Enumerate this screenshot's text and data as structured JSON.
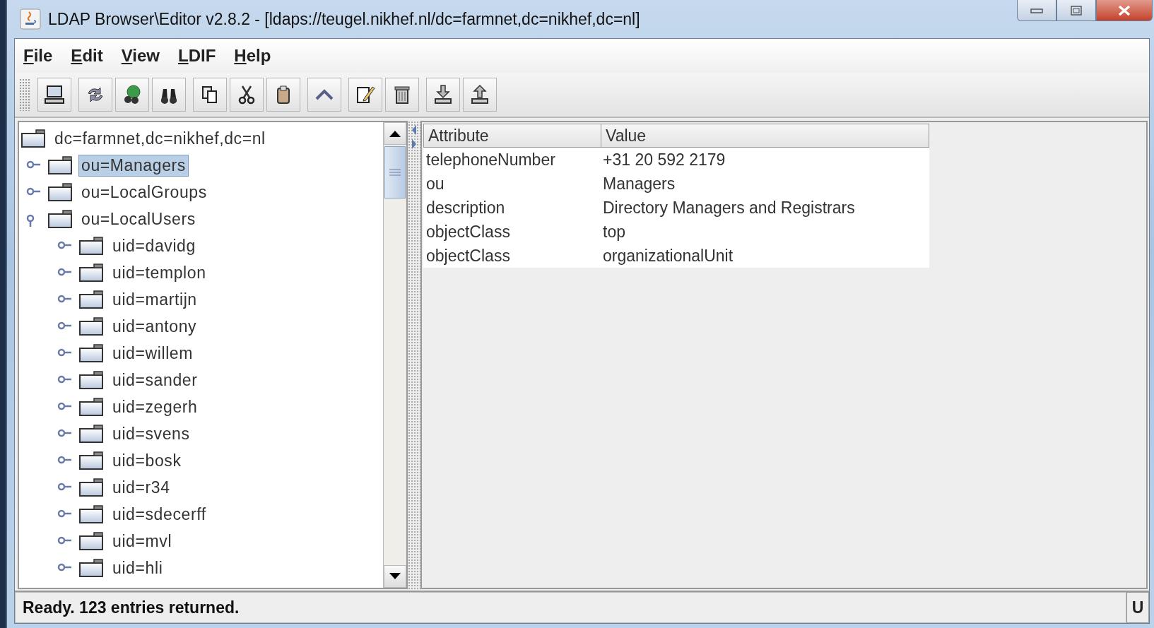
{
  "window": {
    "title": "LDAP Browser\\Editor v2.8.2 - [ldaps://teugel.nikhef.nl/dc=farmnet,dc=nikhef,dc=nl]"
  },
  "menu": [
    "File",
    "Edit",
    "View",
    "LDIF",
    "Help"
  ],
  "tree": [
    {
      "label": "dc=farmnet,dc=nikhef,dc=nl",
      "selected": false,
      "children": [
        {
          "label": "ou=Managers",
          "selected": true,
          "expanded": false
        },
        {
          "label": "ou=LocalGroups",
          "selected": false,
          "expanded": false
        },
        {
          "label": "ou=LocalUsers",
          "selected": false,
          "expanded": true,
          "children": [
            {
              "label": "uid=davidg",
              "selected": false,
              "expanded": false
            },
            {
              "label": "uid=templon",
              "selected": false,
              "expanded": false
            },
            {
              "label": "uid=martijn",
              "selected": false,
              "expanded": false
            },
            {
              "label": "uid=antony",
              "selected": false,
              "expanded": false
            },
            {
              "label": "uid=willem",
              "selected": false,
              "expanded": false
            },
            {
              "label": "uid=sander",
              "selected": false,
              "expanded": false
            },
            {
              "label": "uid=zegerh",
              "selected": false,
              "expanded": false
            },
            {
              "label": "uid=svens",
              "selected": false,
              "expanded": false
            },
            {
              "label": "uid=bosk",
              "selected": false,
              "expanded": false
            },
            {
              "label": "uid=r34",
              "selected": false,
              "expanded": false
            },
            {
              "label": "uid=sdecerff",
              "selected": false,
              "expanded": false
            },
            {
              "label": "uid=mvl",
              "selected": false,
              "expanded": false
            },
            {
              "label": "uid=hli",
              "selected": false,
              "expanded": false
            }
          ]
        }
      ]
    }
  ],
  "table": {
    "columns": [
      "Attribute",
      "Value"
    ],
    "rows": [
      [
        "telephoneNumber",
        "+31 20 592 2179"
      ],
      [
        "ou",
        "Managers"
      ],
      [
        "description",
        "Directory Managers and Registrars"
      ],
      [
        "objectClass",
        "top"
      ],
      [
        "objectClass",
        "organizationalUnit"
      ]
    ]
  },
  "status_bar": {
    "message": "Ready. 123 entries returned.",
    "indicator": "U"
  }
}
